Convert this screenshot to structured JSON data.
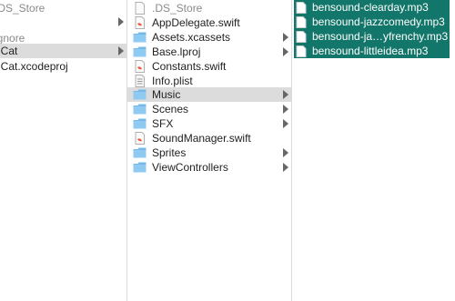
{
  "column1": {
    "items": [
      {
        "name": ".DS_Store",
        "hidden": true
      },
      {
        "name": "ignore",
        "hidden": true
      },
      {
        "name": "nCat",
        "hidden": false
      },
      {
        "name": "nCat.xcodeproj",
        "hidden": false
      }
    ]
  },
  "column2": {
    "items": [
      {
        "name": ".DS_Store",
        "type": "file",
        "hidden": true
      },
      {
        "name": "AppDelegate.swift",
        "type": "swift"
      },
      {
        "name": "Assets.xcassets",
        "type": "folder"
      },
      {
        "name": "Base.lproj",
        "type": "folder"
      },
      {
        "name": "Constants.swift",
        "type": "swift"
      },
      {
        "name": "Info.plist",
        "type": "plist"
      },
      {
        "name": "Music",
        "type": "folder"
      },
      {
        "name": "Scenes",
        "type": "folder"
      },
      {
        "name": "SFX",
        "type": "folder"
      },
      {
        "name": "SoundManager.swift",
        "type": "swift"
      },
      {
        "name": "Sprites",
        "type": "folder"
      },
      {
        "name": "ViewControllers",
        "type": "folder"
      }
    ]
  },
  "column3": {
    "items": [
      {
        "name": "bensound-clearday.mp3",
        "type": "mp3"
      },
      {
        "name": "bensound-jazzcomedy.mp3",
        "type": "mp3"
      },
      {
        "name": "bensound-ja…yfrenchy.mp3",
        "type": "mp3"
      },
      {
        "name": "bensound-littleidea.mp3",
        "type": "mp3"
      }
    ]
  },
  "colors": {
    "selection_active": "#13766a",
    "selection_inactive": "#dcdcdc",
    "folder": "#74b9e8",
    "swift": "#f05138"
  }
}
